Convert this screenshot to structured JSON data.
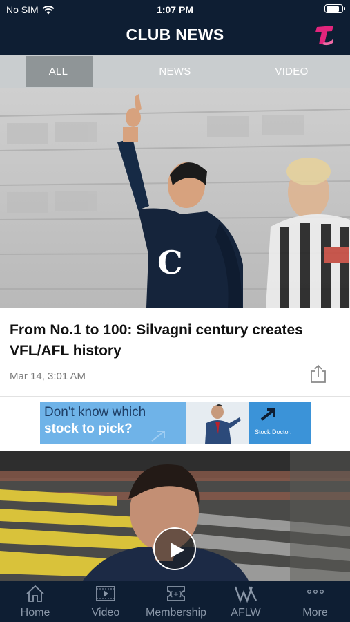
{
  "status_bar": {
    "carrier": "No SIM",
    "time": "1:07 PM",
    "battery_level": 0.9
  },
  "header": {
    "title": "CLUB NEWS",
    "sponsor_icon": "telstra-logo-icon"
  },
  "tabs": [
    {
      "label": "ALL",
      "active": true
    },
    {
      "label": "NEWS",
      "active": false
    },
    {
      "label": "VIDEO",
      "active": false
    }
  ],
  "featured_article": {
    "title": "From No.1 to 100: Silvagni century creates VFL/AFL history",
    "date": "Mar 14, 3:01 AM",
    "share_icon": "share-icon"
  },
  "ad_banner": {
    "line1": "Don't know which",
    "line2": "stock to pick?",
    "brand": "Stock Doctor."
  },
  "video_card": {
    "play_icon": "play-icon"
  },
  "bottom_nav": [
    {
      "label": "Home",
      "icon": "home-icon"
    },
    {
      "label": "Video",
      "icon": "video-icon"
    },
    {
      "label": "Membership",
      "icon": "membership-icon"
    },
    {
      "label": "AFLW",
      "icon": "aflw-icon"
    },
    {
      "label": "More",
      "icon": "more-icon"
    }
  ],
  "colors": {
    "header_bg": "#0e1e33",
    "tab_bar_bg": "#c9cdcf",
    "tab_active_bg": "#8f9597",
    "nav_text": "#8a97a8",
    "telstra_magenta": "#e2257c"
  }
}
